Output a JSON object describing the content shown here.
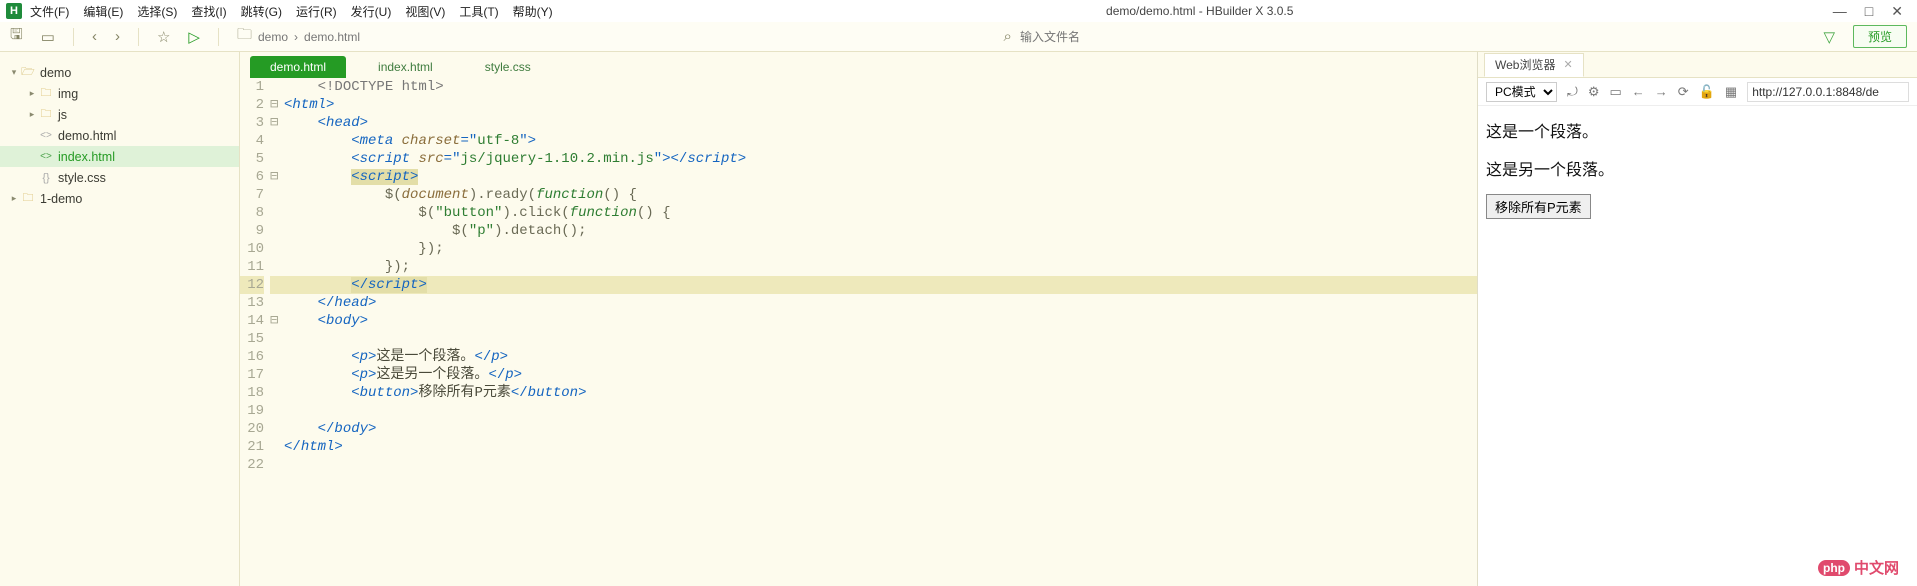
{
  "window": {
    "title": "demo/demo.html - HBuilder X 3.0.5",
    "win_min": "—",
    "win_max": "□",
    "win_close": "✕"
  },
  "menu": [
    "文件(F)",
    "编辑(E)",
    "选择(S)",
    "查找(I)",
    "跳转(G)",
    "运行(R)",
    "发行(U)",
    "视图(V)",
    "工具(T)",
    "帮助(Y)"
  ],
  "toolbar": {
    "breadcrumb": [
      "demo",
      "demo.html"
    ],
    "search_placeholder": "输入文件名",
    "preview_label": "预览"
  },
  "sidebar": {
    "tree": [
      {
        "name": "demo",
        "type": "folder-open",
        "level": 0,
        "expanded": true
      },
      {
        "name": "img",
        "type": "folder",
        "level": 1,
        "collapsed": true
      },
      {
        "name": "js",
        "type": "folder",
        "level": 1,
        "collapsed": true
      },
      {
        "name": "demo.html",
        "type": "html",
        "level": 1
      },
      {
        "name": "index.html",
        "type": "html",
        "level": 1,
        "active": true
      },
      {
        "name": "style.css",
        "type": "css",
        "level": 1
      },
      {
        "name": "1-demo",
        "type": "folder",
        "level": 0,
        "collapsed": true
      }
    ]
  },
  "editor": {
    "tabs": [
      {
        "label": "demo.html",
        "active": true
      },
      {
        "label": "index.html"
      },
      {
        "label": "style.css"
      }
    ],
    "sel_line": 12,
    "gutter": [
      "1",
      "2",
      "3",
      "4",
      "5",
      "6",
      "7",
      "8",
      "9",
      "10",
      "11",
      "12",
      "13",
      "14",
      "15",
      "16",
      "17",
      "18",
      "19",
      "20",
      "21",
      "22"
    ],
    "fold": [
      "",
      "⊟",
      "⊟",
      "",
      "",
      "⊟",
      "",
      "",
      "",
      "",
      "",
      "",
      "",
      "⊟",
      "",
      "",
      "",
      "",
      "",
      "",
      "",
      ""
    ],
    "code": {
      "l1": {
        "indent": "    ",
        "doctype": "<!DOCTYPE html>"
      },
      "l2": {
        "tag_open": "<",
        "tag": "html",
        "tag_close": ">"
      },
      "l3": {
        "indent": "    ",
        "tag_open": "<",
        "tag": "head",
        "tag_close": ">"
      },
      "l4": {
        "indent": "        ",
        "tag_open": "<",
        "tag": "meta",
        "sp": " ",
        "attr": "charset",
        "eq": "=\"",
        "val": "utf-8",
        "close": "\">"
      },
      "l5": {
        "indent": "        ",
        "t1": "<",
        "tag": "script",
        "sp": " ",
        "attr": "src",
        "eq": "=\"",
        "val": "js/jquery-1.10.2.min.js",
        "mid": "\">",
        "t2": "</",
        "tag2": "script",
        "t3": ">"
      },
      "l6": {
        "indent": "        ",
        "t1": "<",
        "tag": "script",
        "t2": ">"
      },
      "l7": {
        "indent": "            ",
        "js": "$(",
        "var": "document",
        "js2": ").ready(",
        "kw": "function",
        "js3": "() {"
      },
      "l8": {
        "indent": "                ",
        "js": "$(",
        "str": "\"button\"",
        "js2": ").click(",
        "kw": "function",
        "js3": "() {"
      },
      "l9": {
        "indent": "                    ",
        "js": "$(",
        "str": "\"p\"",
        "js2": ").detach();"
      },
      "l10": {
        "indent": "                ",
        "js": "});"
      },
      "l11": {
        "indent": "            ",
        "js": "});"
      },
      "l12": {
        "indent": "        ",
        "t1": "</",
        "tag": "script",
        "t2": ">"
      },
      "l13": {
        "indent": "    ",
        "t1": "</",
        "tag": "head",
        "t2": ">"
      },
      "l14": {
        "indent": "    ",
        "t1": "<",
        "tag": "body",
        "t2": ">"
      },
      "l16": {
        "indent": "        ",
        "t1": "<",
        "tag": "p",
        "t2": ">",
        "text": "这是一个段落。",
        "t3": "</",
        "tag2": "p",
        "t4": ">"
      },
      "l17": {
        "indent": "        ",
        "t1": "<",
        "tag": "p",
        "t2": ">",
        "text": "这是另一个段落。",
        "t3": "</",
        "tag2": "p",
        "t4": ">"
      },
      "l18": {
        "indent": "        ",
        "t1": "<",
        "tag": "button",
        "t2": ">",
        "text": "移除所有P元素",
        "t3": "</",
        "tag2": "button",
        "t4": ">"
      },
      "l20": {
        "indent": "    ",
        "t1": "</",
        "tag": "body",
        "t2": ">"
      },
      "l21": {
        "t1": "</",
        "tag": "html",
        "t2": ">"
      }
    }
  },
  "preview": {
    "tab_title": "Web浏览器",
    "mode": "PC模式",
    "url": "http://127.0.0.1:8848/de",
    "para1": "这是一个段落。",
    "para2": "这是另一个段落。",
    "button": "移除所有P元素"
  },
  "watermark": {
    "brand": "php",
    "text": "中文网"
  }
}
